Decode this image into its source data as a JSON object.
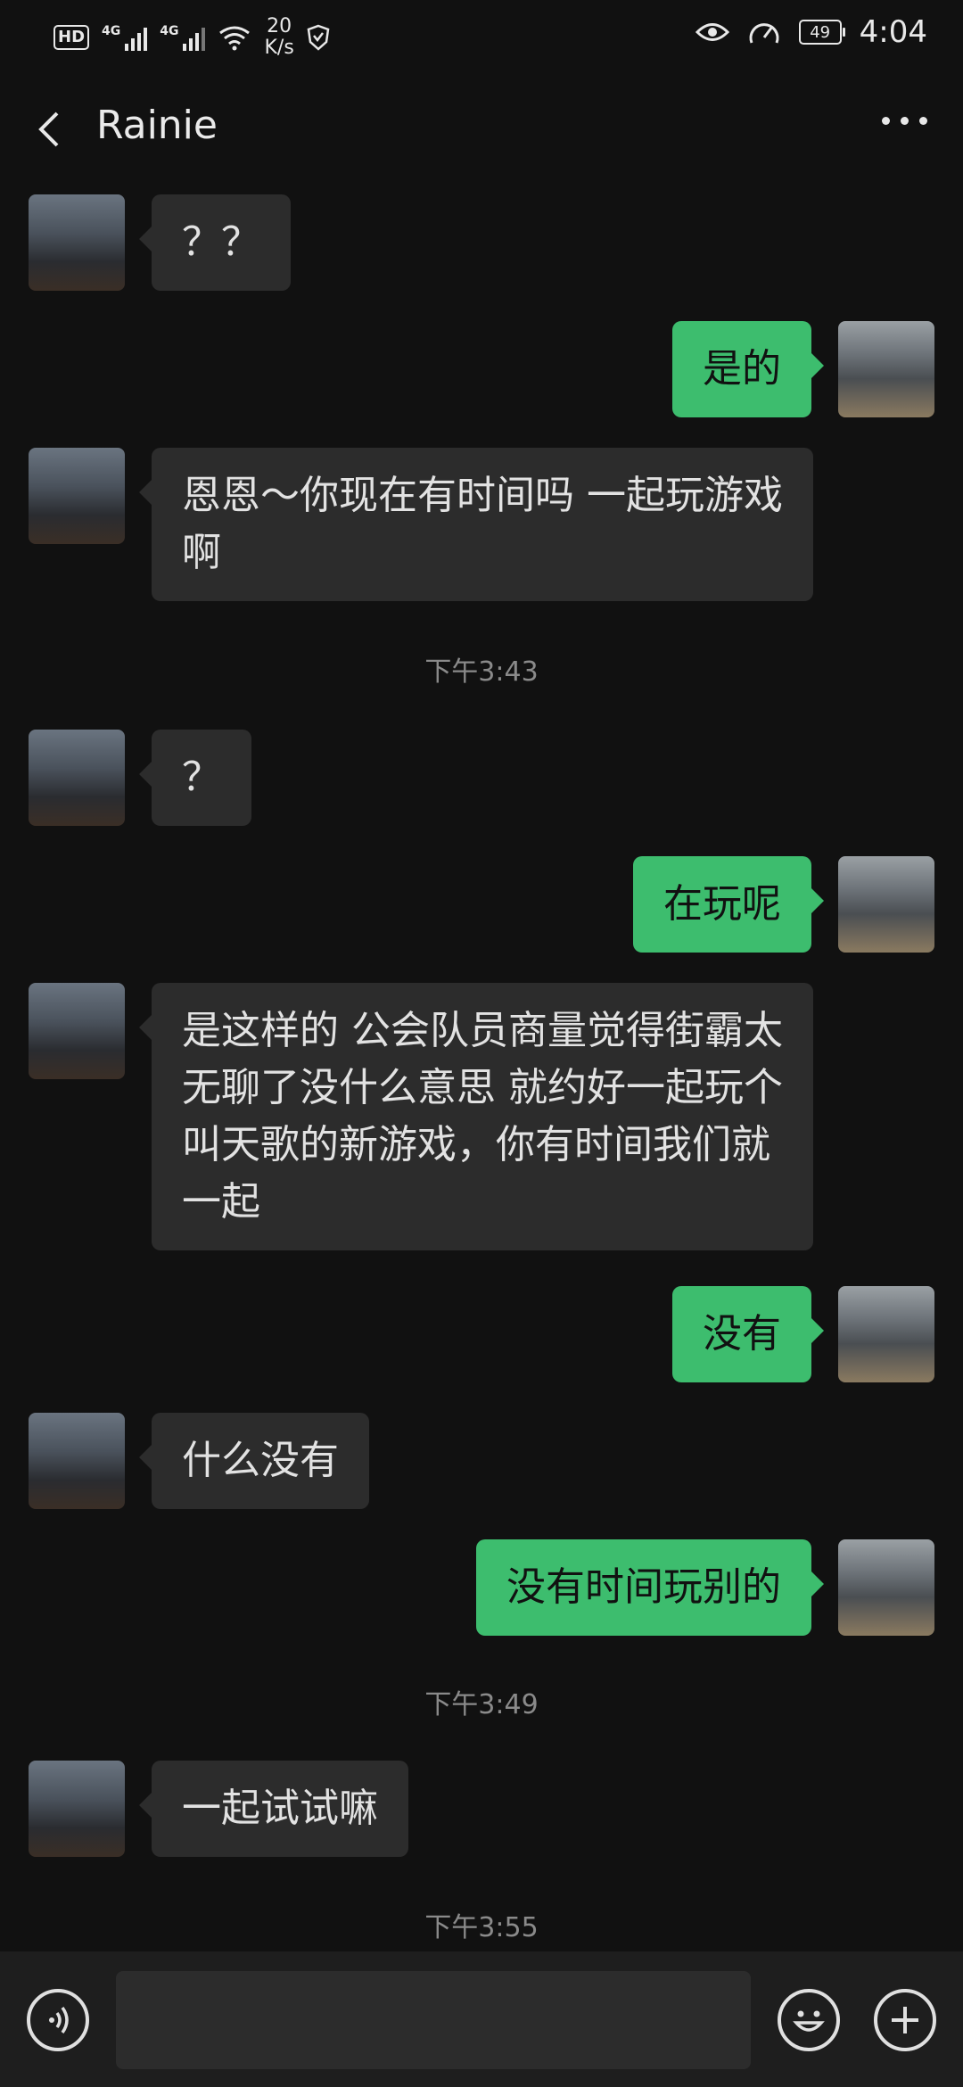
{
  "status_bar": {
    "hd": "HD",
    "sim1_tag": "4G",
    "sim2_tag": "4G",
    "speed_value": "20",
    "speed_unit": "K/s",
    "battery": "49",
    "time": "4:04"
  },
  "header": {
    "title": "Rainie"
  },
  "messages": [
    {
      "text": "？？"
    },
    {
      "text": "是的"
    },
    {
      "text": "恩恩～你现在有时间吗 一起玩游戏啊"
    },
    {
      "text": "下午3:43"
    },
    {
      "text": "？"
    },
    {
      "text": "在玩呢"
    },
    {
      "text": "是这样的 公会队员商量觉得街霸太无聊了没什么意思 就约好一起玩个叫天歌的新游戏，你有时间我们就一起"
    },
    {
      "text": "没有"
    },
    {
      "text": "什么没有"
    },
    {
      "text": "没有时间玩别的"
    },
    {
      "text": "下午3:49"
    },
    {
      "text": "一起试试嘛"
    },
    {
      "text": "下午3:55"
    }
  ],
  "input_bar": {
    "voice_icon": "voice-icon",
    "emoji_icon": "emoji-icon",
    "plus_icon": "plus-icon",
    "input_value": ""
  },
  "colors": {
    "background": "#111111",
    "incoming_bubble": "#2c2c2c",
    "outgoing_bubble": "#3dbd6e",
    "timestamp": "#8a8a8a"
  }
}
